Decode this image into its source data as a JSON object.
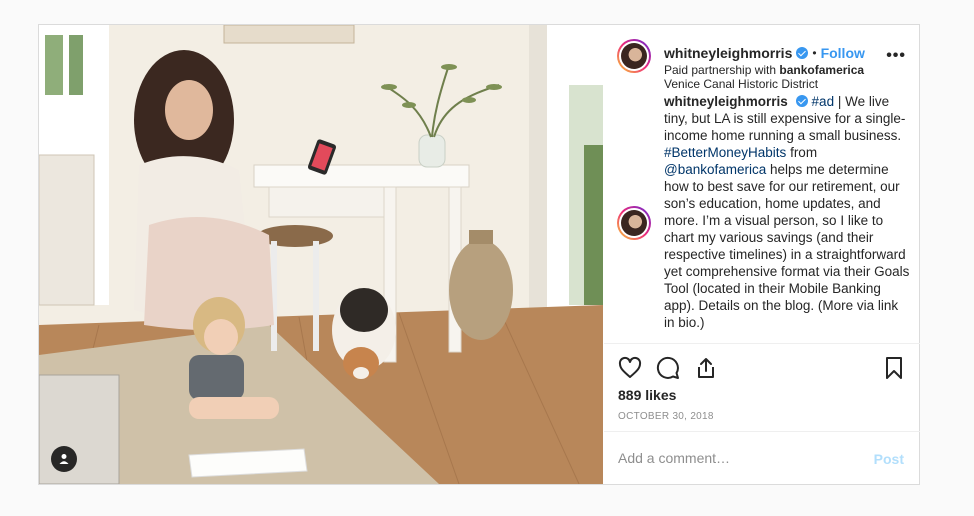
{
  "post": {
    "username": "whitneyleighmorris",
    "follow_label": "Follow",
    "separator": "•",
    "partnership_prefix": "Paid partnership with ",
    "partner": "bankofamerica",
    "location": "Venice Canal Historic District",
    "more_icon": "more-horizontal-icon",
    "more_label": "•••"
  },
  "caption": {
    "username": "whitneyleighmorris",
    "hashtag_ad": "#ad",
    "text1": " | We live tiny, but LA is still expensive for a single-income home running a small business. ",
    "hashtag": "#BetterMoneyHabits",
    "text2": " from ",
    "mention": "@bankofamerica",
    "text3": " helps me determine how to best save for our retirement, our son’s education, home updates, and more. I’m a visual person, so I like to chart my various savings (and their respective timelines) in a straightforward yet comprehensive format via their Goals Tool (located in their Mobile Banking app). Details on the blog. (More via link in bio.)"
  },
  "engagement": {
    "likes": "889 likes",
    "date": "OCTOBER 30, 2018"
  },
  "comment": {
    "placeholder": "Add a comment…",
    "post_label": "Post"
  },
  "colors": {
    "accent": "#3897f0",
    "link": "#003569",
    "post_disabled": "#b2dffc"
  }
}
